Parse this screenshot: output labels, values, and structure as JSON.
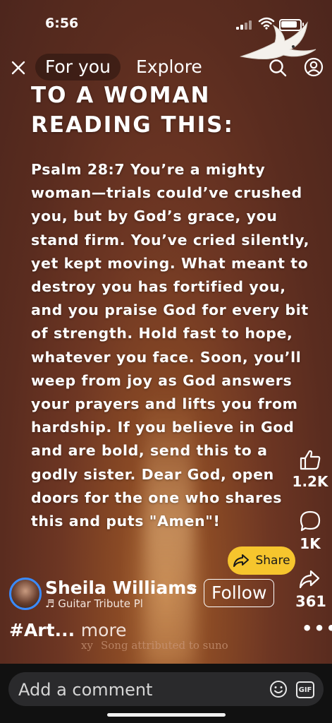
{
  "status_bar": {
    "time": "6:56"
  },
  "topnav": {
    "tabs": [
      {
        "label": "For you",
        "active": true
      },
      {
        "label": "Explore",
        "active": false
      }
    ]
  },
  "post": {
    "headline_lines": [
      "TO A WOMAN",
      "READING THIS:"
    ],
    "body_lines": [
      "Psalm 28:7 You’re a mighty",
      "woman—trials could’ve crushed",
      "you, but by God’s grace, you",
      "stand firm. You’ve cried silently,",
      "yet kept moving. What meant to",
      "destroy you has fortified you,",
      "and you praise God for every bit",
      "of strength. Hold fast to hope,",
      "whatever you face. Soon, you’ll",
      "weep from joy as God answers",
      "your prayers and lifts you from",
      "hardship. If you believe in God",
      "and are bold, send this to a",
      "godly sister. Dear God, open",
      "doors for the one who shares",
      "this and puts \"Amen\"!"
    ]
  },
  "actions": {
    "likes": "1.2K",
    "comments": "1K",
    "share_label": "Share",
    "shares": "361"
  },
  "author": {
    "name": "Sheila Williams",
    "music": "♬ Guitar Tribute Pl",
    "follow_label": "Follow"
  },
  "caption": {
    "hashtag": "#Art...",
    "more": "more"
  },
  "song_credit": {
    "prefix": "xy",
    "text": "Song attributed to suno"
  },
  "comment": {
    "placeholder": "Add a comment",
    "gif_label": "GIF"
  },
  "colors": {
    "share_pill": "#f6c52d",
    "avatar_ring": "#3a8bff",
    "background": "#5a2c1f"
  }
}
